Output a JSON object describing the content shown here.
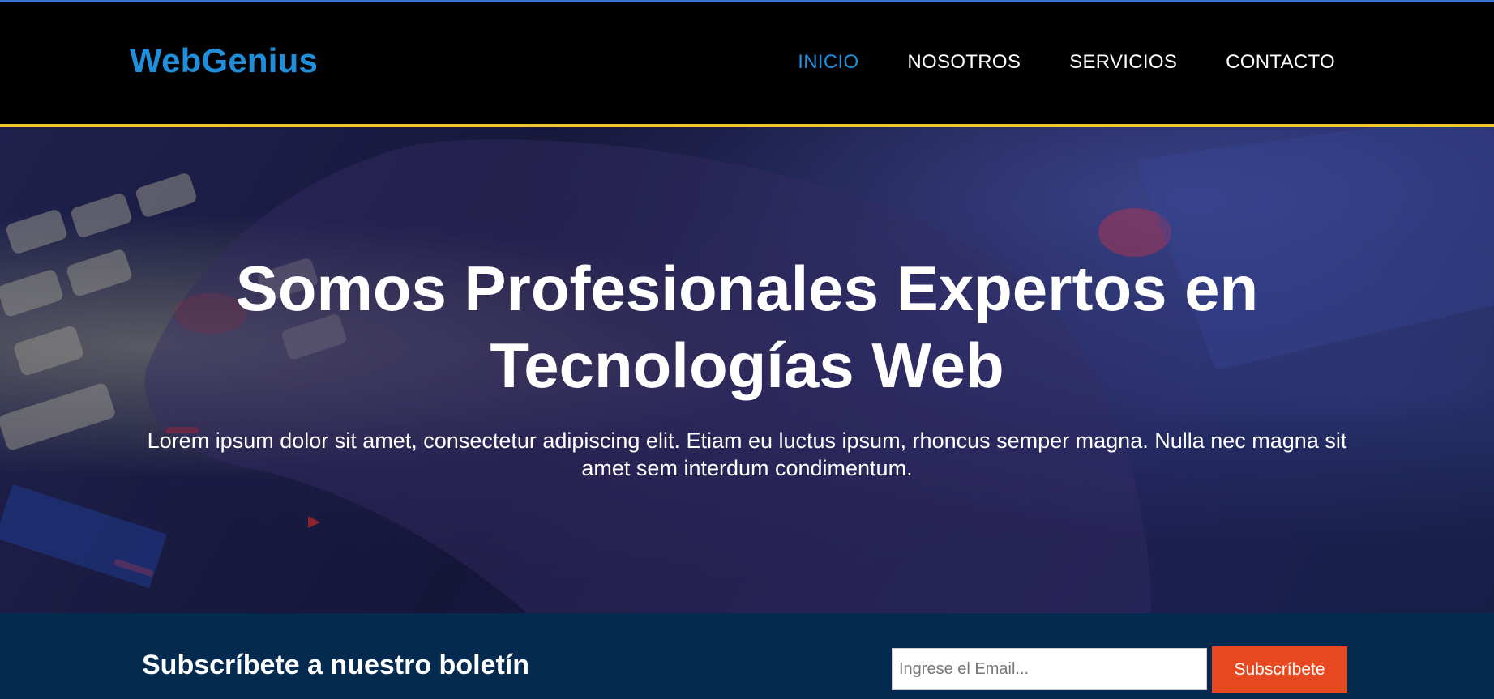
{
  "brand": {
    "name": "WebGenius",
    "color": "#1f8fdc"
  },
  "nav": {
    "items": [
      {
        "label": "INICIO",
        "active": true
      },
      {
        "label": "NOSOTROS",
        "active": false
      },
      {
        "label": "SERVICIOS",
        "active": false
      },
      {
        "label": "CONTACTO",
        "active": false
      }
    ]
  },
  "hero": {
    "title": "Somos Profesionales Expertos en Tecnologías Web",
    "lead": "Lorem ipsum dolor sit amet, consectetur adipiscing elit. Etiam eu luctus ipsum, rhoncus semper magna. Nulla nec magna sit amet sem interdum condimentum."
  },
  "subscribe": {
    "title": "Subscríbete a nuestro boletín",
    "email_placeholder": "Ingrese el Email...",
    "button_label": "Subscríbete"
  },
  "colors": {
    "accent": "#1f8fdc",
    "nav_border": "#f2c12e",
    "subscribe_bg": "#052a50",
    "button_bg": "#e8481f"
  }
}
